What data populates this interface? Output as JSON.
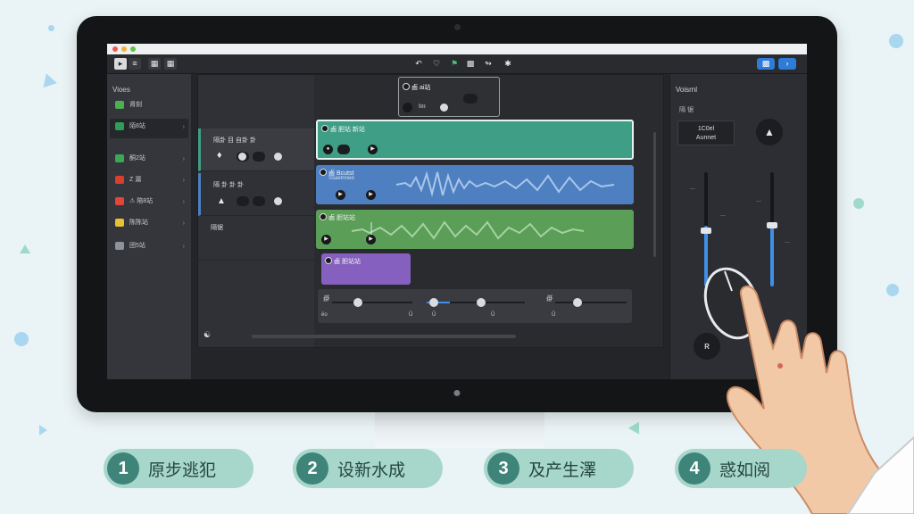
{
  "library": {
    "title": "Vioes",
    "items": [
      {
        "label": "肾刻",
        "sub": "",
        "color": "#4caf50"
      },
      {
        "label": "陌8站",
        "sub": "",
        "color": "#2e9e58"
      },
      {
        "label": "酮2站",
        "sub": "",
        "color": "#3aa856"
      },
      {
        "label": "Z 漏",
        "sub": "",
        "color": "#d8402e"
      },
      {
        "label": "⚠ 陪8站",
        "sub": "",
        "color": "#e2453a"
      },
      {
        "label": "陈陈站",
        "sub": "",
        "color": "#e6c232"
      },
      {
        "label": "团5站",
        "sub": "",
        "color": "#8e9399"
      }
    ]
  },
  "track_headers": [
    {
      "label": "隔卦 目 自卦 卦"
    },
    {
      "label": "隔 卦 卦 卦"
    },
    {
      "label": "隔锯"
    }
  ],
  "float_panel": {
    "title": "鹵 ai站",
    "sub": "Iııı"
  },
  "regions": [
    {
      "title": "鹵 胆站 新站",
      "sub": "",
      "color": "#3f9f86"
    },
    {
      "title": "鹵 Bcutst",
      "sub": "Ssaetnned",
      "color": "#4d7fc1"
    },
    {
      "title": "鹵 胆站站",
      "sub": "",
      "color": "#5a9e57"
    },
    {
      "title": "鹵 胆站站",
      "sub": "",
      "color": "#8560bf"
    }
  ],
  "mixer": {
    "labels": [
      "ēo",
      "Ū",
      "Ū",
      "Ū",
      "Ū"
    ]
  },
  "volume": {
    "title": "Voisrnl",
    "sub": "隔 锯",
    "automation": "1C0el\nAunnet",
    "scale": [
      "—",
      "—",
      "—",
      "—",
      "—",
      "—"
    ],
    "button_label": "ʀ"
  },
  "steps": [
    {
      "num": "1",
      "label": "原步逃犯",
      "bg": "#a7d6cb"
    },
    {
      "num": "2",
      "label": "设新水成",
      "bg": "#a7d6cb"
    },
    {
      "num": "3",
      "label": "及产生澤",
      "bg": "#a7d6cb"
    },
    {
      "num": "4",
      "label": "惑如阅",
      "bg": "#a7d6cb"
    }
  ]
}
